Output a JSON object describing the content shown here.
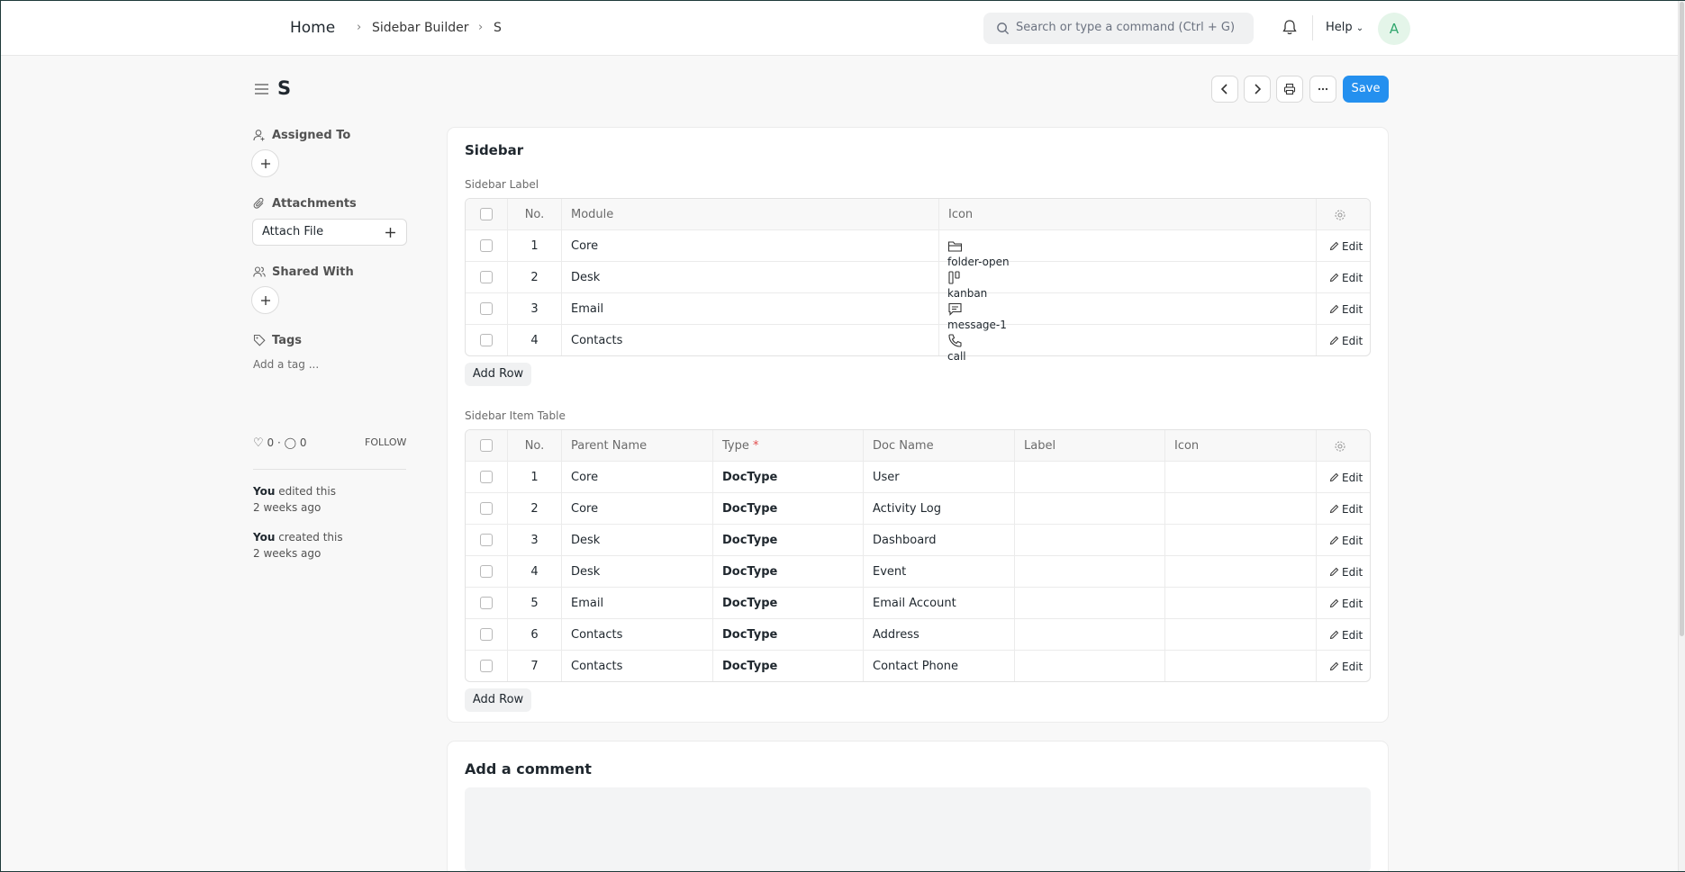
{
  "navbar": {
    "breadcrumbs": [
      "Home",
      "Sidebar Builder",
      "S"
    ],
    "search_placeholder": "Search or type a command (Ctrl + G)",
    "help_label": "Help",
    "avatar_initial": "A"
  },
  "page": {
    "title": "S",
    "save_label": "Save"
  },
  "sidebar": {
    "assigned_to": "Assigned To",
    "attachments": "Attachments",
    "attach_file": "Attach File",
    "shared_with": "Shared With",
    "tags": "Tags",
    "add_tag": "Add a tag ...",
    "likes": "0",
    "comments": "0",
    "follow": "FOLLOW",
    "activity": [
      {
        "who": "You",
        "what": " edited this",
        "when": "2 weeks ago"
      },
      {
        "who": "You",
        "what": " created this",
        "when": "2 weeks ago"
      }
    ]
  },
  "section": {
    "title": "Sidebar",
    "label_table_title": "Sidebar Label",
    "label_headers": {
      "no": "No.",
      "module": "Module",
      "icon": "Icon"
    },
    "label_rows": [
      {
        "no": "1",
        "module": "Core",
        "icon": "folder-open"
      },
      {
        "no": "2",
        "module": "Desk",
        "icon": "kanban"
      },
      {
        "no": "3",
        "module": "Email",
        "icon": "message-1"
      },
      {
        "no": "4",
        "module": "Contacts",
        "icon": "call"
      }
    ],
    "item_table_title": "Sidebar Item Table",
    "item_headers": {
      "no": "No.",
      "parent": "Parent Name",
      "type": "Type",
      "req": "*",
      "doc": "Doc Name",
      "label": "Label",
      "icon": "Icon"
    },
    "item_rows": [
      {
        "no": "1",
        "parent": "Core",
        "type": "DocType",
        "doc": "User"
      },
      {
        "no": "2",
        "parent": "Core",
        "type": "DocType",
        "doc": "Activity Log"
      },
      {
        "no": "3",
        "parent": "Desk",
        "type": "DocType",
        "doc": "Dashboard"
      },
      {
        "no": "4",
        "parent": "Desk",
        "type": "DocType",
        "doc": "Event"
      },
      {
        "no": "5",
        "parent": "Email",
        "type": "DocType",
        "doc": "Email Account"
      },
      {
        "no": "6",
        "parent": "Contacts",
        "type": "DocType",
        "doc": "Address"
      },
      {
        "no": "7",
        "parent": "Contacts",
        "type": "DocType",
        "doc": "Contact Phone"
      }
    ],
    "edit_label": "Edit",
    "add_row_label": "Add Row"
  },
  "comment": {
    "title": "Add a comment"
  },
  "colors": {
    "accent": "#2490ef",
    "avatar_bg": "#e4f5e9",
    "avatar_fg": "#30a66d",
    "required": "#e24c4c"
  }
}
